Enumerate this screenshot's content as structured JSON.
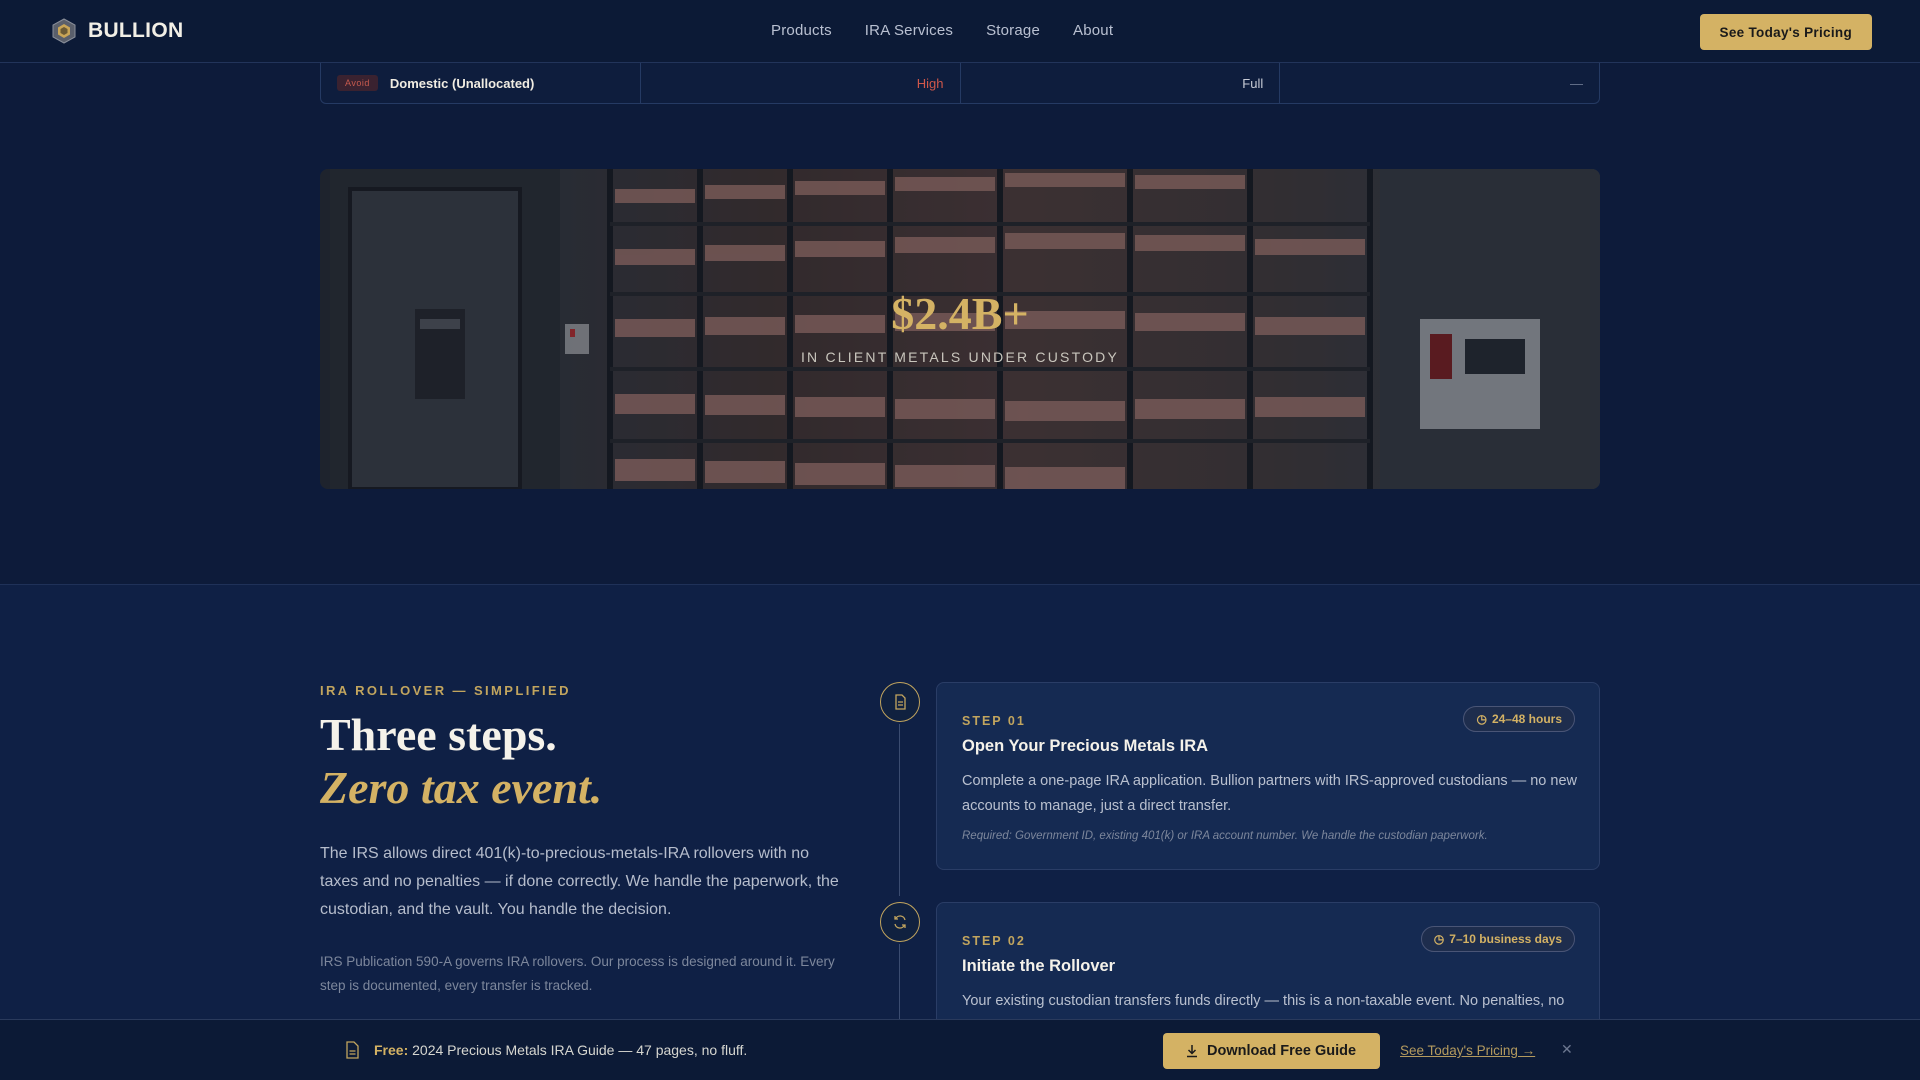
{
  "brand": {
    "name": "BULLION",
    "logo_icon": "hexagon-logo-icon"
  },
  "nav": {
    "links": [
      "Products",
      "IRA Services",
      "Storage",
      "About"
    ],
    "cta_label": "See Today's Pricing"
  },
  "comparison_row": {
    "badge": "Avoid",
    "name": "Domestic (Unallocated)",
    "risk": "High",
    "coverage": "Full",
    "extra": "—"
  },
  "vault": {
    "stat": "$2.4B+",
    "caption": "IN CLIENT METALS UNDER CUSTODY"
  },
  "rollover": {
    "eyebrow": "IRA ROLLOVER — SIMPLIFIED",
    "heading_line1": "Three steps.",
    "heading_line2": "Zero tax event.",
    "lead": "The IRS allows direct 401(k)-to-precious-metals-IRA rollovers with no taxes and no penalties — if done correctly. We handle the paperwork, the custodian, and the vault. You handle the decision.",
    "fine_print": "IRS Publication 590-A governs IRA rollovers. Our process is designed around it. Every step is documented, every transfer is tracked.",
    "steps": [
      {
        "number": "STEP 01",
        "title": "Open Your Precious Metals IRA",
        "badge": "24–48 hours",
        "icon": "document-icon",
        "description": "Complete a one-page IRA application. Bullion partners with IRS-approved custodians — no new accounts to manage, just a direct transfer.",
        "required": "Required: Government ID, existing 401(k) or IRA account number. We handle the custodian paperwork."
      },
      {
        "number": "STEP 02",
        "title": "Initiate the Rollover",
        "badge": "7–10 business days",
        "icon": "refresh-icon",
        "description": "Your existing custodian transfers funds directly — this is a non-taxable event. No penalties, no IRS"
      }
    ]
  },
  "sticky_bar": {
    "free_label": "Free:",
    "text": "2024 Precious Metals IRA Guide — 47 pages, no fluff.",
    "button_label": "Download Free Guide",
    "link_label": "See Today's Pricing →",
    "close_label": "✕"
  },
  "colors": {
    "accent_gold": "#d4b264",
    "background_navy": "#0d1b3a",
    "danger_red": "#d0574a"
  }
}
